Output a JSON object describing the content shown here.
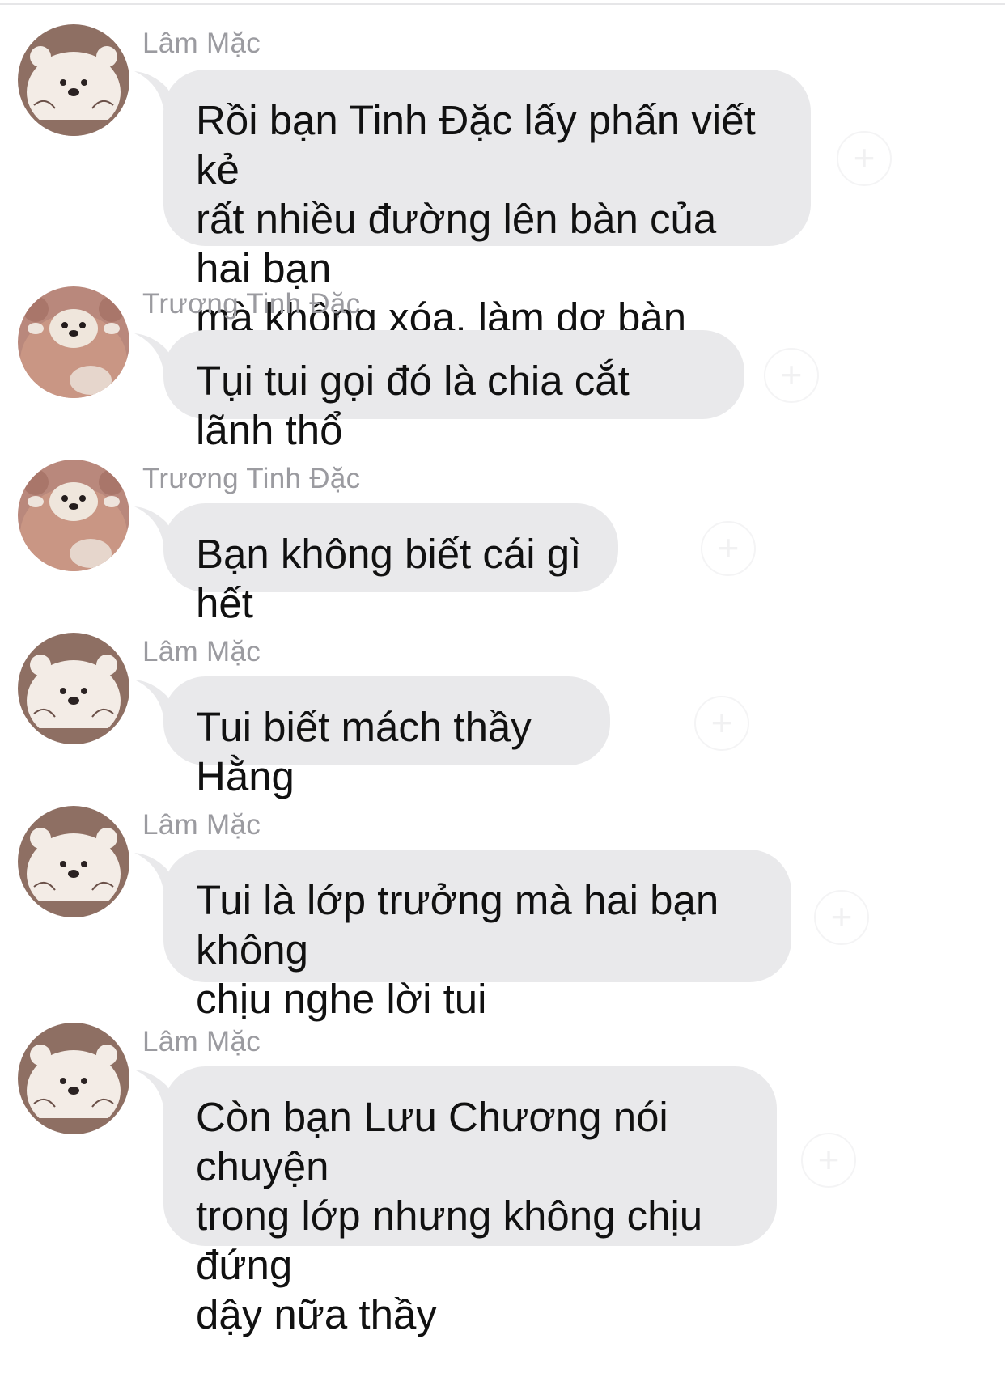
{
  "messages": [
    {
      "sender": "Lâm Mặc",
      "avatar": "white-bear-avatar",
      "text": "Rồi bạn Tinh Đặc lấy phấn viết kẻ\nrất nhiều đường lên bàn của hai bạn\nmà không xóa, làm dơ bàn"
    },
    {
      "sender": "Trương Tinh Đặc",
      "avatar": "brown-bear-hood-avatar",
      "text": "Tụi tui gọi đó là chia cắt lãnh thổ"
    },
    {
      "sender": "Trương Tinh Đặc",
      "avatar": "brown-bear-hood-avatar",
      "text": "Bạn không biết cái gì hết"
    },
    {
      "sender": "Lâm Mặc",
      "avatar": "white-bear-avatar",
      "text": "Tui biết mách thầy Hằng"
    },
    {
      "sender": "Lâm Mặc",
      "avatar": "white-bear-avatar",
      "text": "Tui là lớp trưởng mà hai bạn không\nchịu nghe lời tui"
    },
    {
      "sender": "Lâm Mặc",
      "avatar": "white-bear-avatar",
      "text": "Còn bạn Lưu Chương nói chuyện\ntrong lớp nhưng không chịu đứng\ndậy nữa thầy"
    }
  ],
  "colors": {
    "bubble": "#e9e9eb",
    "sender_name": "#9b9ba0",
    "text": "#111111",
    "background": "#ffffff"
  }
}
